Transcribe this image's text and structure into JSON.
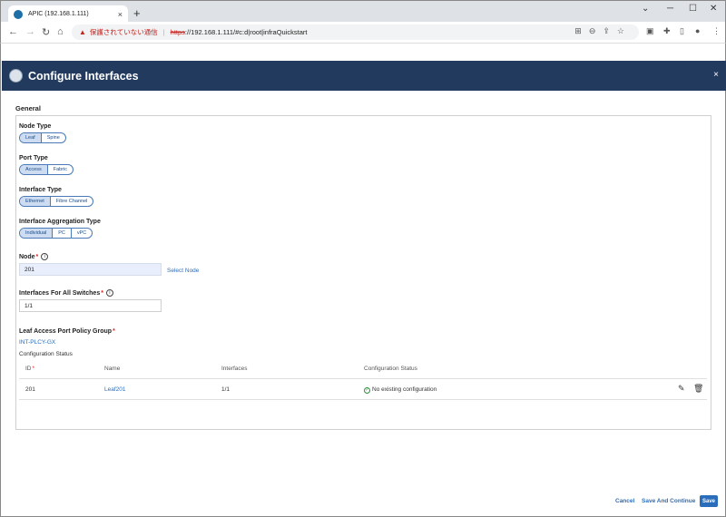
{
  "browser": {
    "tab_title": "APIC (192.168.1.111)",
    "tab_close": "×",
    "new_tab": "+",
    "security_label": "保護されていない通信",
    "url_scheme": "https",
    "url_rest": "://192.168.1.111/#c:d|root|infraQuickstart",
    "win_min": "─",
    "win_max": "☐",
    "win_close": "✕"
  },
  "modal": {
    "title": "Configure Interfaces",
    "close": "×"
  },
  "form": {
    "section_title": "General",
    "node_type": {
      "label": "Node Type",
      "options": [
        "Leaf",
        "Spine"
      ],
      "selected": "Leaf"
    },
    "port_type": {
      "label": "Port Type",
      "options": [
        "Access",
        "Fabric"
      ],
      "selected": "Access"
    },
    "interface_type": {
      "label": "Interface Type",
      "options": [
        "Ethernet",
        "Fibre Channel"
      ],
      "selected": "Ethernet"
    },
    "aggregation_type": {
      "label": "Interface Aggregation Type",
      "options": [
        "Individual",
        "PC",
        "vPC"
      ],
      "selected": "Individual"
    },
    "node": {
      "label": "Node",
      "value": "201",
      "select_link": "Select Node"
    },
    "interfaces": {
      "label": "Interfaces For All Switches",
      "value": "1/1"
    },
    "policy_group": {
      "label": "Leaf Access Port Policy Group",
      "value": "INT-PLCY-GX"
    }
  },
  "config_table": {
    "label": "Configuration Status",
    "headers": [
      "ID",
      "Name",
      "Interfaces",
      "Configuration Status"
    ],
    "rows": [
      {
        "id": "201",
        "name": "Leaf201",
        "interfaces": "1/1",
        "status": "No existing configuration"
      }
    ]
  },
  "footer": {
    "cancel": "Cancel",
    "save_continue": "Save And Continue",
    "save": "Save"
  },
  "colors": {
    "header_bg": "#223a5e",
    "accent": "#2a6ebb",
    "selected_segment": "#cddcf0"
  }
}
